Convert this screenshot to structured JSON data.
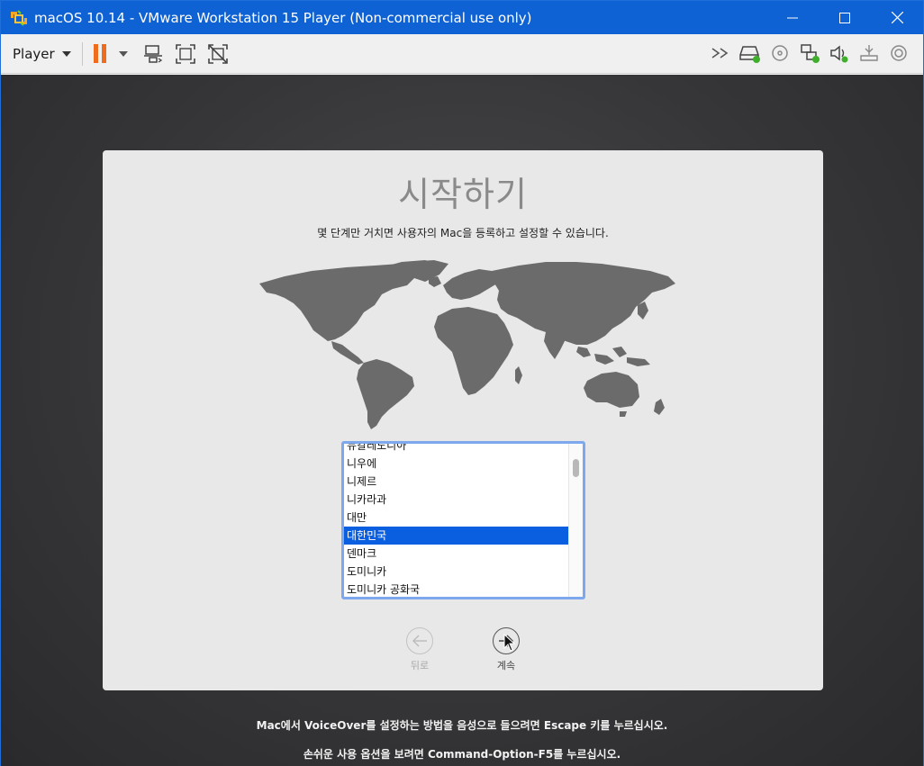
{
  "window": {
    "title": "macOS 10.14 - VMware Workstation 15 Player (Non-commercial use only)"
  },
  "toolbar": {
    "player_label": "Player"
  },
  "setup": {
    "title": "시작하기",
    "subtitle": "몇 단계만 거치면 사용자의 Mac을 등록하고 설정할 수 있습니다.",
    "countries": [
      "뉴칼레도니아",
      "니우에",
      "니제르",
      "니카라과",
      "대만",
      "대한민국",
      "덴마크",
      "도미니카",
      "도미니카 공화국"
    ],
    "selected_country": "대한민국",
    "back_label": "뒤로",
    "continue_label": "계속"
  },
  "footer": {
    "line1": "Mac에서 VoiceOver를 설정하는 방법을 음성으로 들으려면 Escape 키를 누르십시오.",
    "line2": "손쉬운 사용 옵션을 보려면 Command-Option-F5를 누르십시오."
  },
  "colors": {
    "titlebar": "#0f62d3",
    "selection": "#0a5fe0",
    "pause_icon": "#ef6b1e"
  }
}
